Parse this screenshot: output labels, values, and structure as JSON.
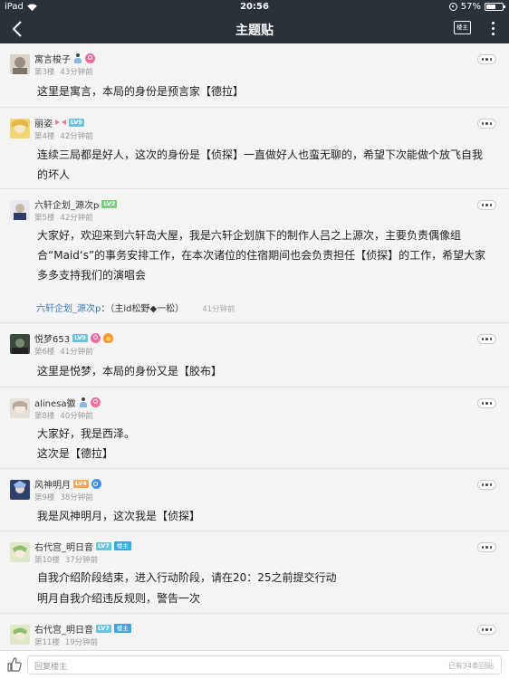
{
  "status_bar": {
    "device": "iPad",
    "time": "20:56",
    "battery": "57%",
    "battery_level": 0.57
  },
  "nav": {
    "title": "主题贴",
    "louzhu_label": "楼主"
  },
  "posts": [
    {
      "name": "寓言梭子",
      "floor": "第3楼",
      "time": "43分钟前",
      "text": "这里是寓言，本局的身份是预言家【德拉】"
    },
    {
      "name": "丽姿",
      "level": "LV9",
      "floor": "第4楼",
      "time": "42分钟前",
      "text": "连续三局都是好人，这次的身份是【侦探】一直做好人也蛮无聊的，希望下次能做个放飞自我的坏人"
    },
    {
      "name": "六轩企划_源次p",
      "level": "LV2",
      "floor": "第5楼",
      "time": "42分钟前",
      "text": "大家好，欢迎来到六轩岛大屋，我是六轩企划旗下的制作人吕之上源次，主要负责偶像组合“Maid‘s”的事务安排工作，在本次诸位的住宿期间也会负责担任【侦探】的工作，希望大家多多支持我们的演唱会",
      "reply": {
        "name": "六轩企划_源次p",
        "text": "：（主id松野◆一松）",
        "time": "41分钟前"
      }
    },
    {
      "name": "悦梦653",
      "level": "LV9",
      "floor": "第6楼",
      "time": "41分钟前",
      "text": "这里是悦梦，本局的身份又是【胶布】"
    },
    {
      "name": "alinesa徽",
      "floor": "第8楼",
      "time": "40分钟前",
      "text": "大家好，我是西泽。",
      "text2": "这次是【德拉】"
    },
    {
      "name": "风神明月",
      "level": "LV4",
      "floor": "第9楼",
      "time": "38分钟前",
      "text": "我是风神明月，这次我是【侦探】"
    },
    {
      "name": "右代宫_明日音",
      "level": "LV7",
      "badge": "楼主",
      "floor": "第10楼",
      "time": "37分钟前",
      "text": "自我介绍阶段结束，进入行动阶段，请在20：25之前提交行动",
      "text2": "明月自我介绍违反规则，警告一次"
    },
    {
      "name": "右代宫_明日音",
      "level": "LV7",
      "badge": "楼主",
      "floor": "第11楼",
      "time": "19分钟前"
    }
  ],
  "bottom": {
    "placeholder": "回复楼主",
    "count": "已有34条回贴"
  }
}
